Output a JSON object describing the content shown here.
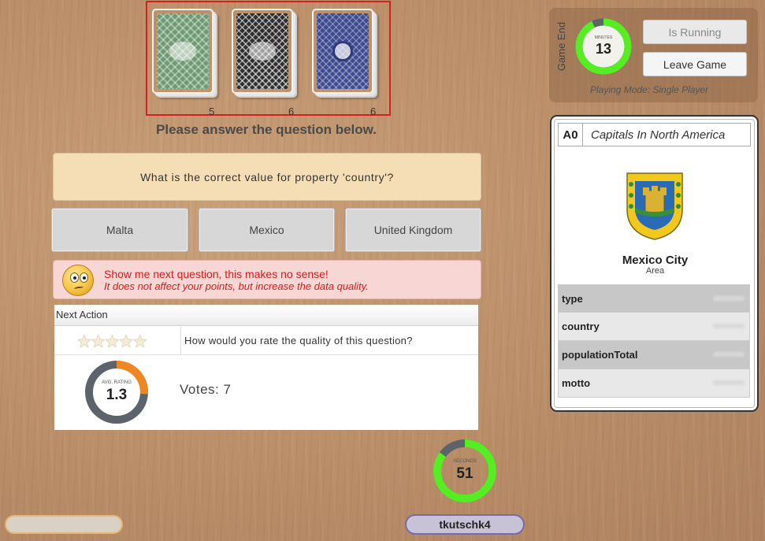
{
  "decks": [
    {
      "count": "5"
    },
    {
      "count": "6"
    },
    {
      "count": "6"
    }
  ],
  "prompt": "Please answer the question below.",
  "question": "What is the correct value for property 'country'?",
  "answers": [
    "Malta",
    "Mexico",
    "United Kingdom"
  ],
  "skip": {
    "line1": "Show me next question, this makes no sense!",
    "line2": "It does not affect your points, but increase the data quality."
  },
  "next_action": {
    "header": "Next Action",
    "stars": "★★★★★",
    "rate_prompt": "How would you rate the quality of this question?",
    "avg_label": "AVG. RATING",
    "avg_value": "1.3",
    "avg_fraction": 0.26,
    "votes": "Votes: 7"
  },
  "timer": {
    "label": "SECONDS",
    "value": "51",
    "fraction": 0.85
  },
  "user": {
    "name": "tkutschk4"
  },
  "game": {
    "end_label": "Game End",
    "minutes_label": "MINUTES",
    "minutes_value": "13",
    "minutes_fraction": 0.93,
    "is_running_label": "Is Running",
    "leave_label": "Leave Game",
    "playing_mode": "Playing Mode: Single Player"
  },
  "card": {
    "id": "A0",
    "category": "Capitals In North America",
    "name": "Mexico City",
    "subtitle": "Area",
    "properties": [
      "type",
      "country",
      "populationTotal",
      "motto"
    ]
  },
  "colors": {
    "ring_green": "#55ee22",
    "ring_gray": "#5c636b",
    "ring_orange": "#f0861f",
    "danger_red": "#d11d1d"
  }
}
